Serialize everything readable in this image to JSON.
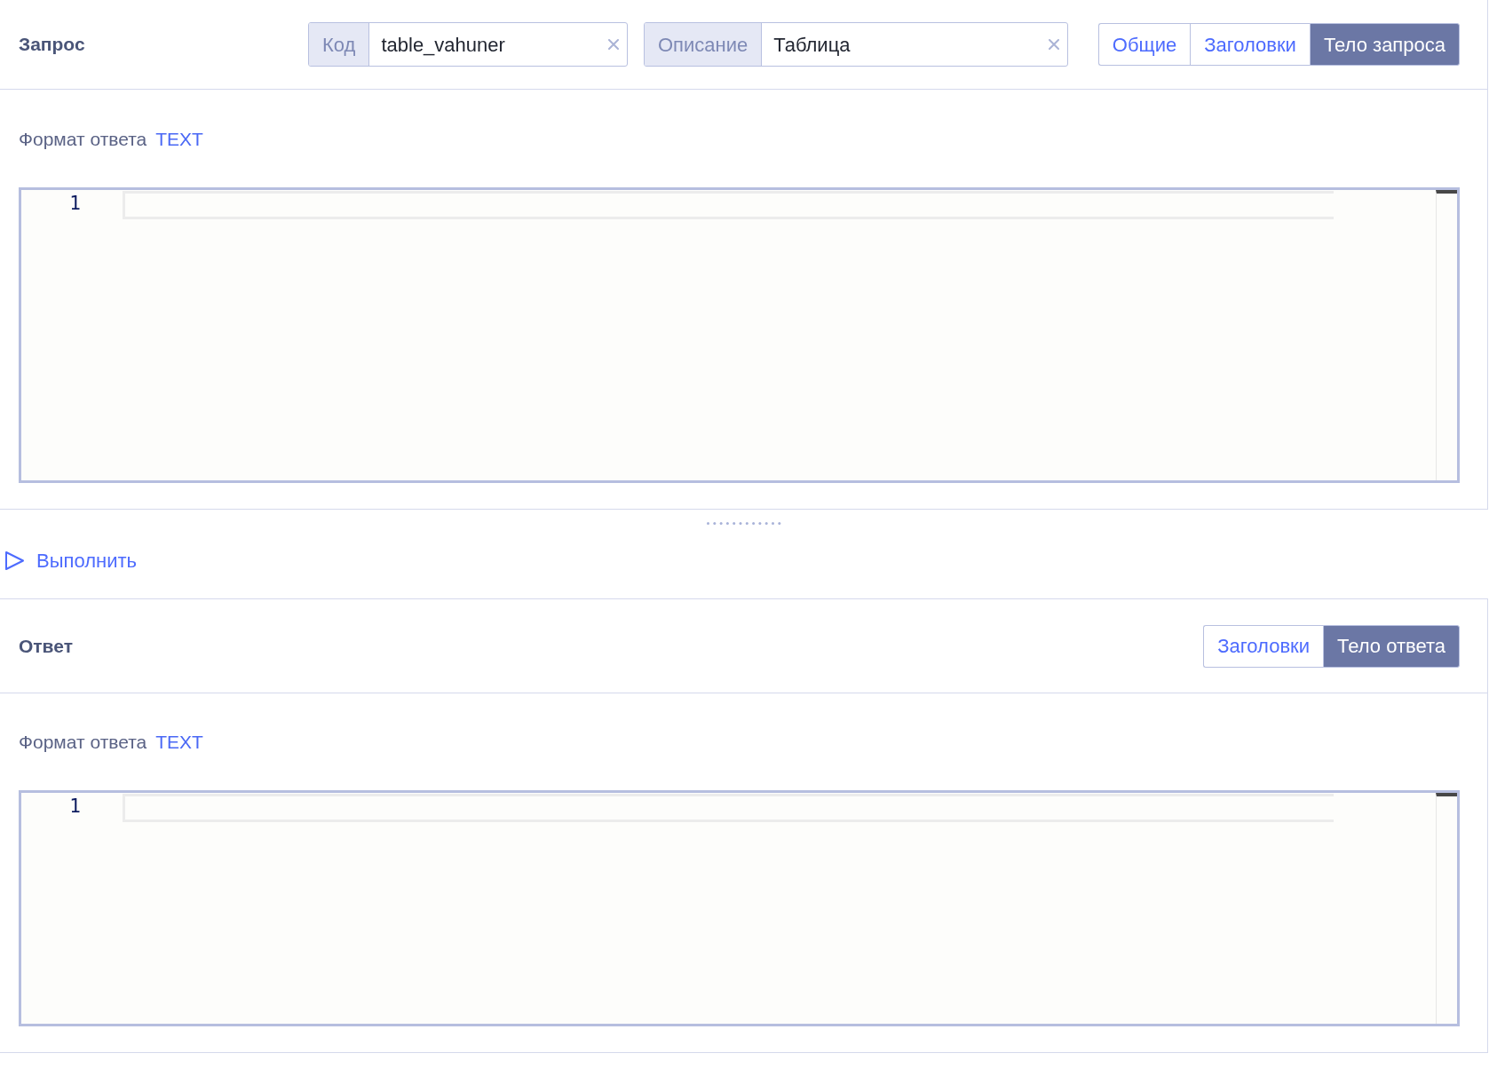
{
  "request": {
    "title": "Запрос",
    "fields": [
      {
        "label": "Код",
        "value": "table_vahuner"
      },
      {
        "label": "Описание",
        "value": "Таблица"
      }
    ],
    "tabs": [
      {
        "label": "Общие",
        "selected": false
      },
      {
        "label": "Заголовки",
        "selected": false
      },
      {
        "label": "Тело запроса",
        "selected": true
      }
    ],
    "format": {
      "label": "Формат ответа",
      "value": "TEXT"
    },
    "editor": {
      "line_numbers": [
        "1"
      ]
    }
  },
  "run_button": {
    "label": "Выполнить"
  },
  "response": {
    "title": "Ответ",
    "tabs": [
      {
        "label": "Заголовки",
        "selected": false
      },
      {
        "label": "Тело ответа",
        "selected": true
      }
    ],
    "format": {
      "label": "Формат ответа",
      "value": "TEXT"
    },
    "editor": {
      "line_numbers": [
        "1"
      ]
    }
  }
}
